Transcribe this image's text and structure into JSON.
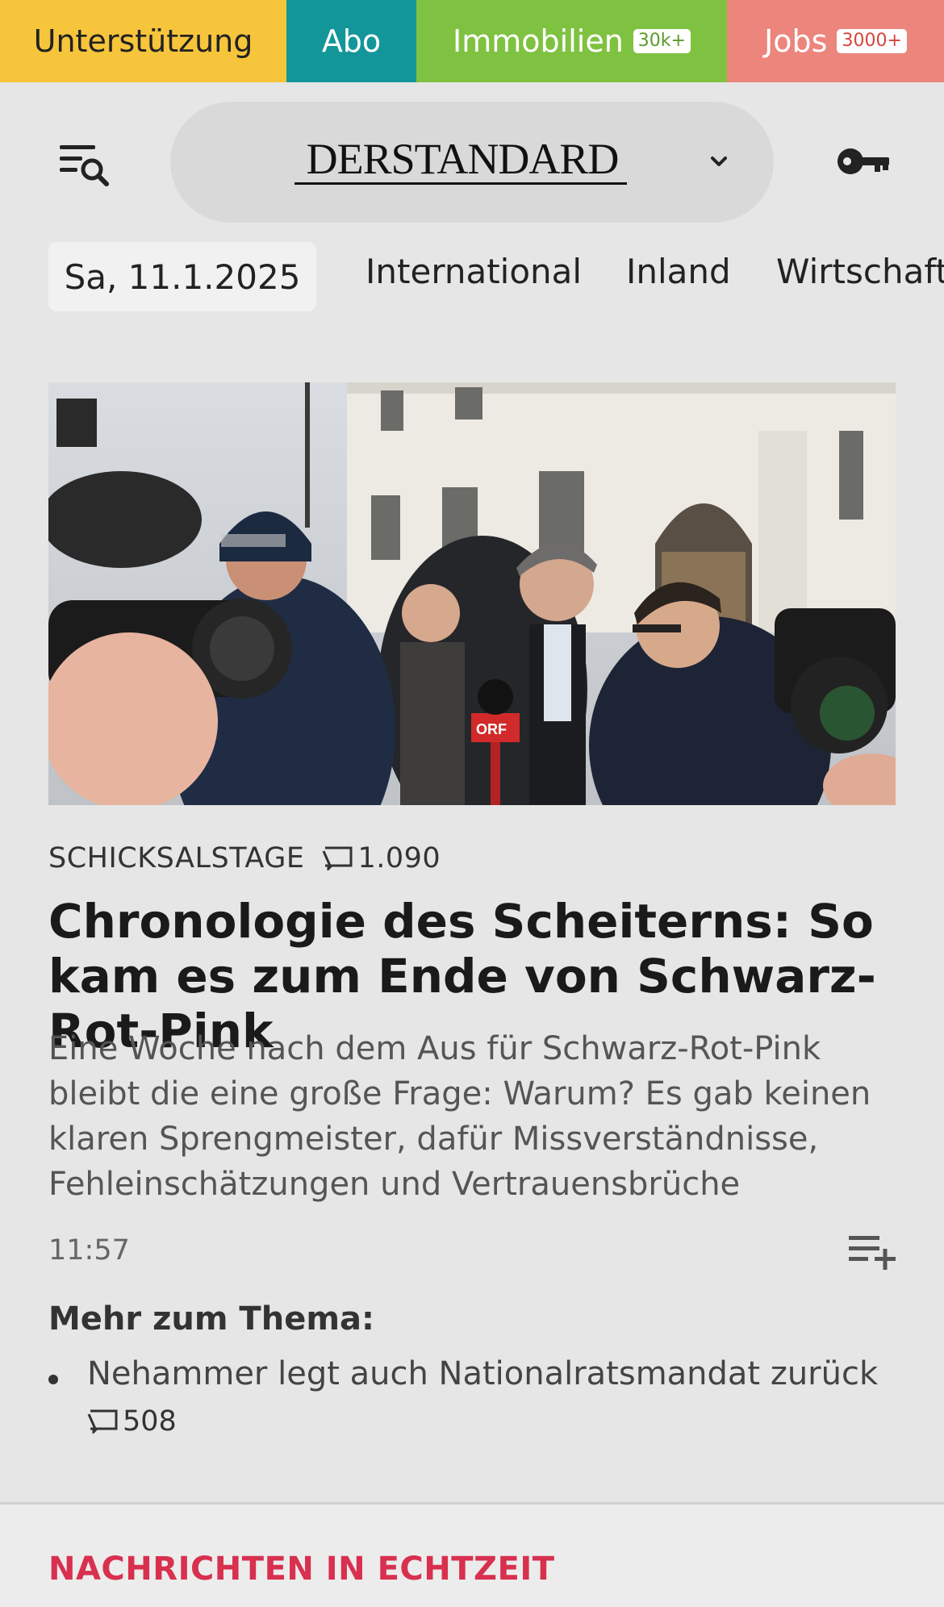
{
  "topbar": {
    "support": "Unterstützung",
    "abo": "Abo",
    "immobilien": "Immobilien",
    "immobilien_badge": "30k+",
    "jobs": "Jobs",
    "jobs_badge": "3000+"
  },
  "header": {
    "logo": "DERSTANDARD"
  },
  "nav": {
    "date": "Sa, 11.1.2025",
    "items": [
      "International",
      "Inland",
      "Wirtschaft"
    ]
  },
  "article": {
    "kicker": "SCHICKSALSTAGE",
    "comments": "1.090",
    "headline": "Chronologie des Scheiterns: So kam es zum Ende von Schwarz-Rot-Pink",
    "teaser": "Eine Woche nach dem Aus für Schwarz-Rot-Pink bleibt die eine große Frage: Warum? Es gab keinen klaren Sprengmeister, dafür Missverständnisse, Fehleinschätzungen und Vertrauensbrüche",
    "time": "11:57"
  },
  "related": {
    "title": "Mehr zum Thema:",
    "items": [
      {
        "label": "Nehammer legt auch Nationalratsmandat zurück",
        "comments": "508"
      }
    ]
  },
  "section": {
    "live_title": "NACHRICHTEN IN ECHTZEIT"
  },
  "colors": {
    "support": "#f7c53b",
    "abo": "#13969a",
    "immobilien": "#7fc241",
    "jobs": "#ec857c",
    "accent": "#d8304f"
  },
  "icons": [
    "menu-search-icon",
    "chevron-down-icon",
    "key-icon",
    "comment-icon",
    "playlist-add-icon"
  ]
}
